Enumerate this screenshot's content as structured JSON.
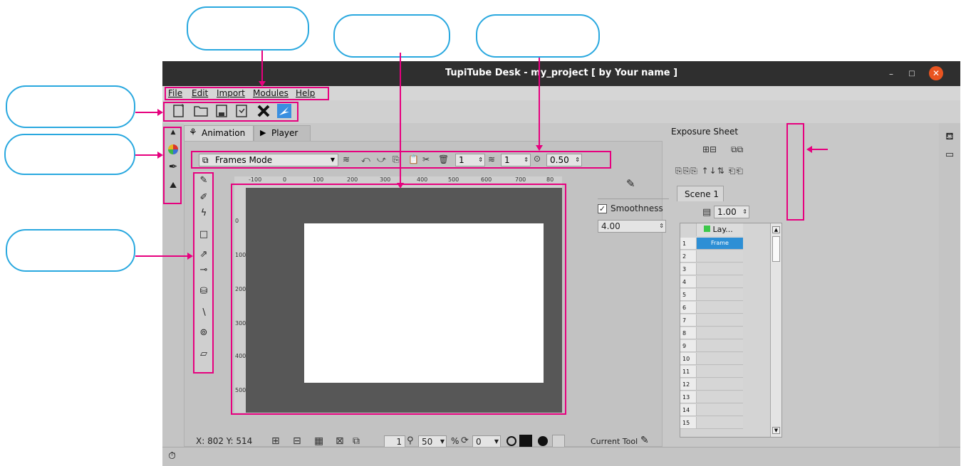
{
  "window": {
    "title": "TupiTube Desk - my_project [ by Your name ]",
    "minimize_glyph": "–",
    "maximize_glyph": "□",
    "close_glyph": "✕"
  },
  "menus": [
    {
      "label": "File"
    },
    {
      "label": "Edit"
    },
    {
      "label": "Import"
    },
    {
      "label": "Modules"
    },
    {
      "label": "Help"
    }
  ],
  "toolbar": [
    "new-icon",
    "open-icon",
    "save-icon",
    "save-as-icon",
    "close-project-icon",
    "tupitube-icon"
  ],
  "left_modules": [
    "arrow-up-icon",
    "color-palette-icon",
    "brush-icon",
    "library-icon"
  ],
  "tabs": [
    {
      "label": "Animation",
      "icon": "animation-icon"
    },
    {
      "label": "Player",
      "icon": "play-icon"
    }
  ],
  "mode_bar": {
    "mode": "Frames Mode",
    "spin_previous": "1",
    "spin_next": "1",
    "opacity": "0.50"
  },
  "ruler": {
    "top": [
      "-100",
      "0",
      "100",
      "200",
      "300",
      "400",
      "500",
      "600",
      "700",
      "80"
    ],
    "left": [
      "0",
      "100",
      "200",
      "300",
      "400",
      "500"
    ]
  },
  "tool_properties": {
    "smoothness_label": "Smoothness",
    "smoothness_checked": true,
    "smoothness_value": "4.00"
  },
  "status": {
    "coords": "X: 802 Y: 514",
    "frame": "1",
    "zoom": "50",
    "zoom_unit": "%",
    "rotation": "0",
    "current_tool_label": "Current Tool"
  },
  "exposure": {
    "title": "Exposure Sheet",
    "scene_tab": "Scene 1",
    "fps": "1.00",
    "layer_label": "Lay...",
    "frame_label": "Frame",
    "rows": [
      "1",
      "2",
      "3",
      "4",
      "5",
      "6",
      "7",
      "8",
      "9",
      "10",
      "11",
      "12",
      "13",
      "14",
      "15"
    ]
  },
  "right_modules": [
    "exposure-sheet-icon",
    "timeline-icon"
  ],
  "colors": {
    "callout_border": "#29a8df",
    "highlight": "#e6007e",
    "titlebar": "#2f2f2f",
    "close_button": "#e95420",
    "canvas_bg": "#575757",
    "frame_selected": "#2d8fd5",
    "layer_green": "#3cc84a"
  }
}
